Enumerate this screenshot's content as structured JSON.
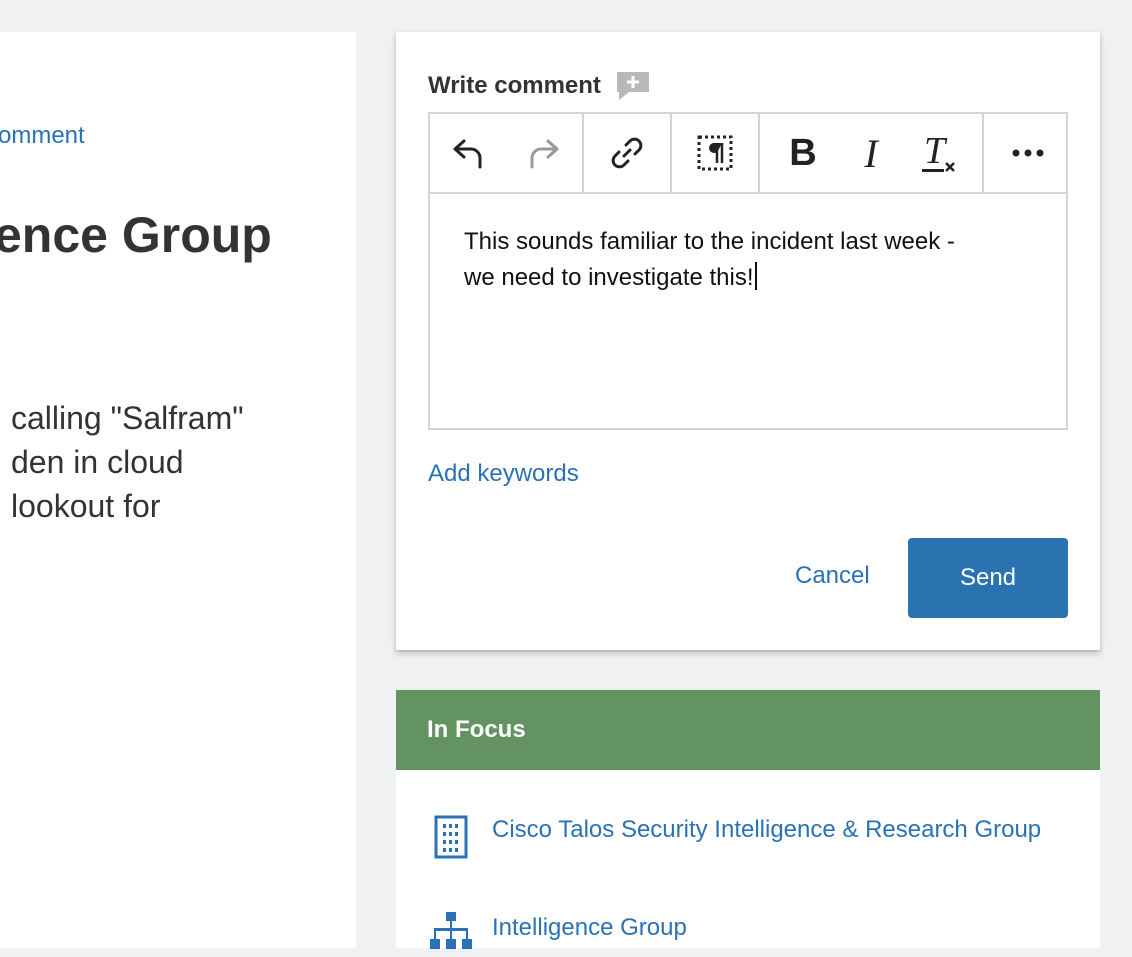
{
  "article": {
    "comment_link": "omment",
    "title": "ence Group",
    "body_lines": [
      " calling \"Salfram\"",
      "den in cloud",
      " lookout for"
    ]
  },
  "comment": {
    "label": "Write comment",
    "text_line1": "This sounds familiar to the incident last week -",
    "text_line2": "we need to investigate this!",
    "add_keywords": "Add keywords",
    "cancel": "Cancel",
    "send": "Send",
    "toolbar": {
      "bold_glyph": "B",
      "italic_glyph": "I",
      "clear_format_glyph": "T",
      "icons": [
        "undo-icon",
        "redo-icon",
        "link-icon",
        "show-blocks-icon",
        "bold-icon",
        "italic-icon",
        "remove-format-icon",
        "more-icon"
      ]
    }
  },
  "in_focus": {
    "title": "In Focus",
    "items": [
      {
        "label": "Cisco Talos Security Intelligence & Research Group",
        "icon": "building-icon"
      },
      {
        "label": "Intelligence Group",
        "icon": "org-chart-icon"
      }
    ]
  },
  "colors": {
    "accent": "#2a72b5",
    "send_button": "#2a72b0",
    "focus_header": "#629361",
    "background": "#f0f1f3"
  }
}
